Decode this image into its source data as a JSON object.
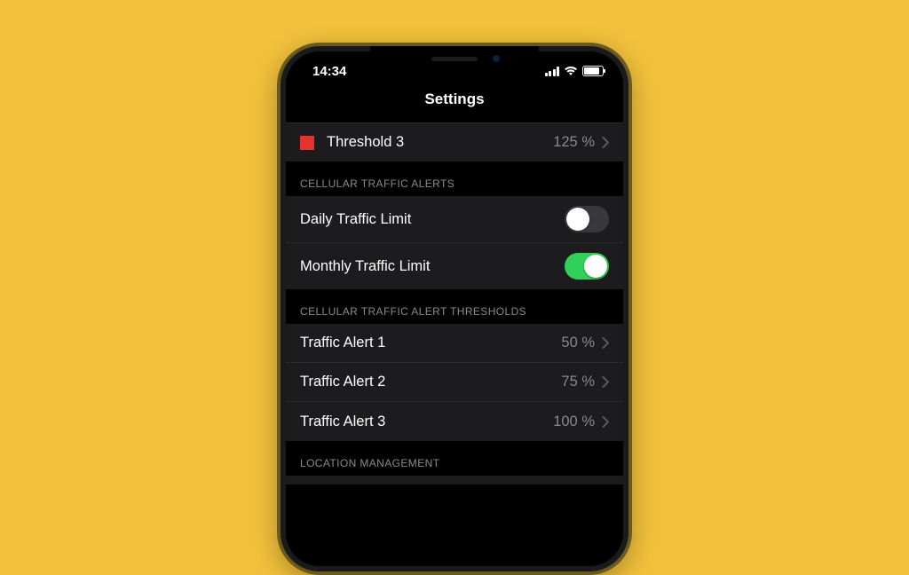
{
  "statusbar": {
    "time": "14:34"
  },
  "navbar": {
    "title": "Settings"
  },
  "threshold_row": {
    "label": "Threshold 3",
    "value": "125 %",
    "swatch_color": "#e5322d"
  },
  "sections": {
    "traffic_alerts": {
      "header": "CELLULAR TRAFFIC ALERTS",
      "rows": [
        {
          "label": "Daily Traffic Limit",
          "on": false
        },
        {
          "label": "Monthly Traffic Limit",
          "on": true
        }
      ]
    },
    "thresholds": {
      "header": "CELLULAR TRAFFIC ALERT THRESHOLDS",
      "rows": [
        {
          "label": "Traffic Alert 1",
          "value": "50 %"
        },
        {
          "label": "Traffic Alert 2",
          "value": "75 %"
        },
        {
          "label": "Traffic Alert 3",
          "value": "100 %"
        }
      ]
    },
    "location": {
      "header": "LOCATION MANAGEMENT"
    }
  },
  "icons": {
    "chevron": "chevron-right-icon",
    "signal": "cellular-signal-icon",
    "wifi": "wifi-icon",
    "battery": "battery-icon"
  }
}
